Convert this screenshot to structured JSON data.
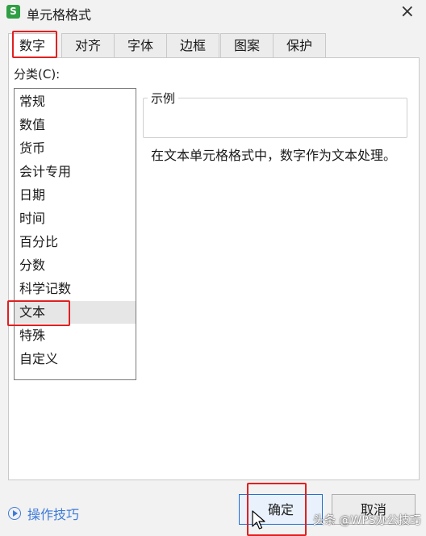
{
  "window": {
    "title": "单元格格式",
    "app_icon_letter": "S",
    "close_glyph": "×"
  },
  "tabs": [
    {
      "label": "数字",
      "active": true
    },
    {
      "label": "对齐",
      "active": false
    },
    {
      "label": "字体",
      "active": false
    },
    {
      "label": "边框",
      "active": false
    },
    {
      "label": "图案",
      "active": false
    },
    {
      "label": "保护",
      "active": false
    }
  ],
  "category": {
    "label": "分类(C):",
    "items": [
      "常规",
      "数值",
      "货币",
      "会计专用",
      "日期",
      "时间",
      "百分比",
      "分数",
      "科学记数",
      "文本",
      "特殊",
      "自定义"
    ],
    "selected": "文本"
  },
  "sample": {
    "legend": "示例",
    "value": ""
  },
  "description": "在文本单元格格式中，数字作为文本处理。",
  "footer": {
    "tips_link": "操作技巧",
    "ok_label": "确定",
    "cancel_label": "取消"
  },
  "watermark": "头条 @WPS办公技巧",
  "colors": {
    "highlight_red": "#e02020",
    "link_blue": "#3d7bd9",
    "app_icon_green": "#2f9e44"
  },
  "icons": [
    "app-icon",
    "close-icon",
    "play-circle-icon",
    "mouse-cursor-icon"
  ]
}
